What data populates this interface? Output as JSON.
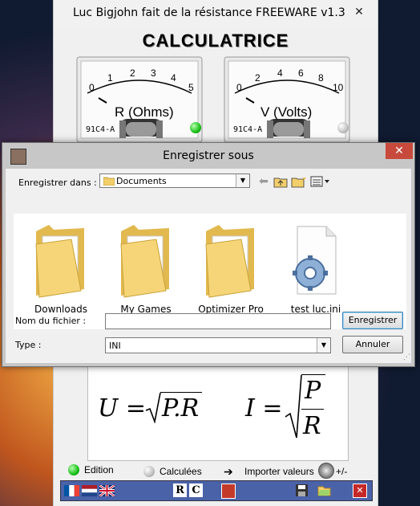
{
  "app": {
    "window_title": "Luc Bigjohn fait de la résistance  FREEWARE v1.3",
    "close_glyph": "✕",
    "heading": "CALCULATRICE",
    "meters": [
      {
        "unit_label": "R (Ohms)",
        "ticks": [
          "0",
          "1",
          "2",
          "3",
          "4",
          "5"
        ],
        "model": "91C4-A",
        "led": "green"
      },
      {
        "unit_label": "V (Volts)",
        "ticks": [
          "0",
          "2",
          "4",
          "6",
          "8",
          "10"
        ],
        "model": "91C4-A",
        "led": "grey"
      }
    ],
    "formulas": {
      "u_lhs": "U =",
      "u_rhs": "P.R",
      "i_lhs": "I =",
      "i_num": "P",
      "i_den": "R"
    },
    "legend": {
      "edition": "Edition",
      "calculees": "Calculées",
      "importer": "Importer valeurs",
      "plusminus": "+/-",
      "arrow_glyph": "➔"
    },
    "toolbar": {
      "r_label": "R",
      "c_label": "C"
    }
  },
  "dialog": {
    "title": "Enregistrer sous",
    "close_glyph": "✕",
    "save_in_label": "Enregistrer dans :",
    "save_in_value": "Documents",
    "files": [
      {
        "name": "Downloads",
        "icon": "folder-icon"
      },
      {
        "name": "My Games",
        "icon": "folder-icon"
      },
      {
        "name": "Optimizer Pro",
        "icon": "folder-icon"
      },
      {
        "name": "test luc.ini",
        "icon": "settings-file-icon"
      }
    ],
    "filename_label": "Nom du fichier :",
    "filename_value": "",
    "type_label": "Type :",
    "type_value": "INI",
    "save_button": "Enregistrer",
    "cancel_button": "Annuler"
  },
  "colors": {
    "dialog_frame": "#c7c7c7",
    "close_red": "#c84a3c",
    "toolbar_blue": "#4a62a8",
    "folder_yellow": "#f3cf6b"
  }
}
